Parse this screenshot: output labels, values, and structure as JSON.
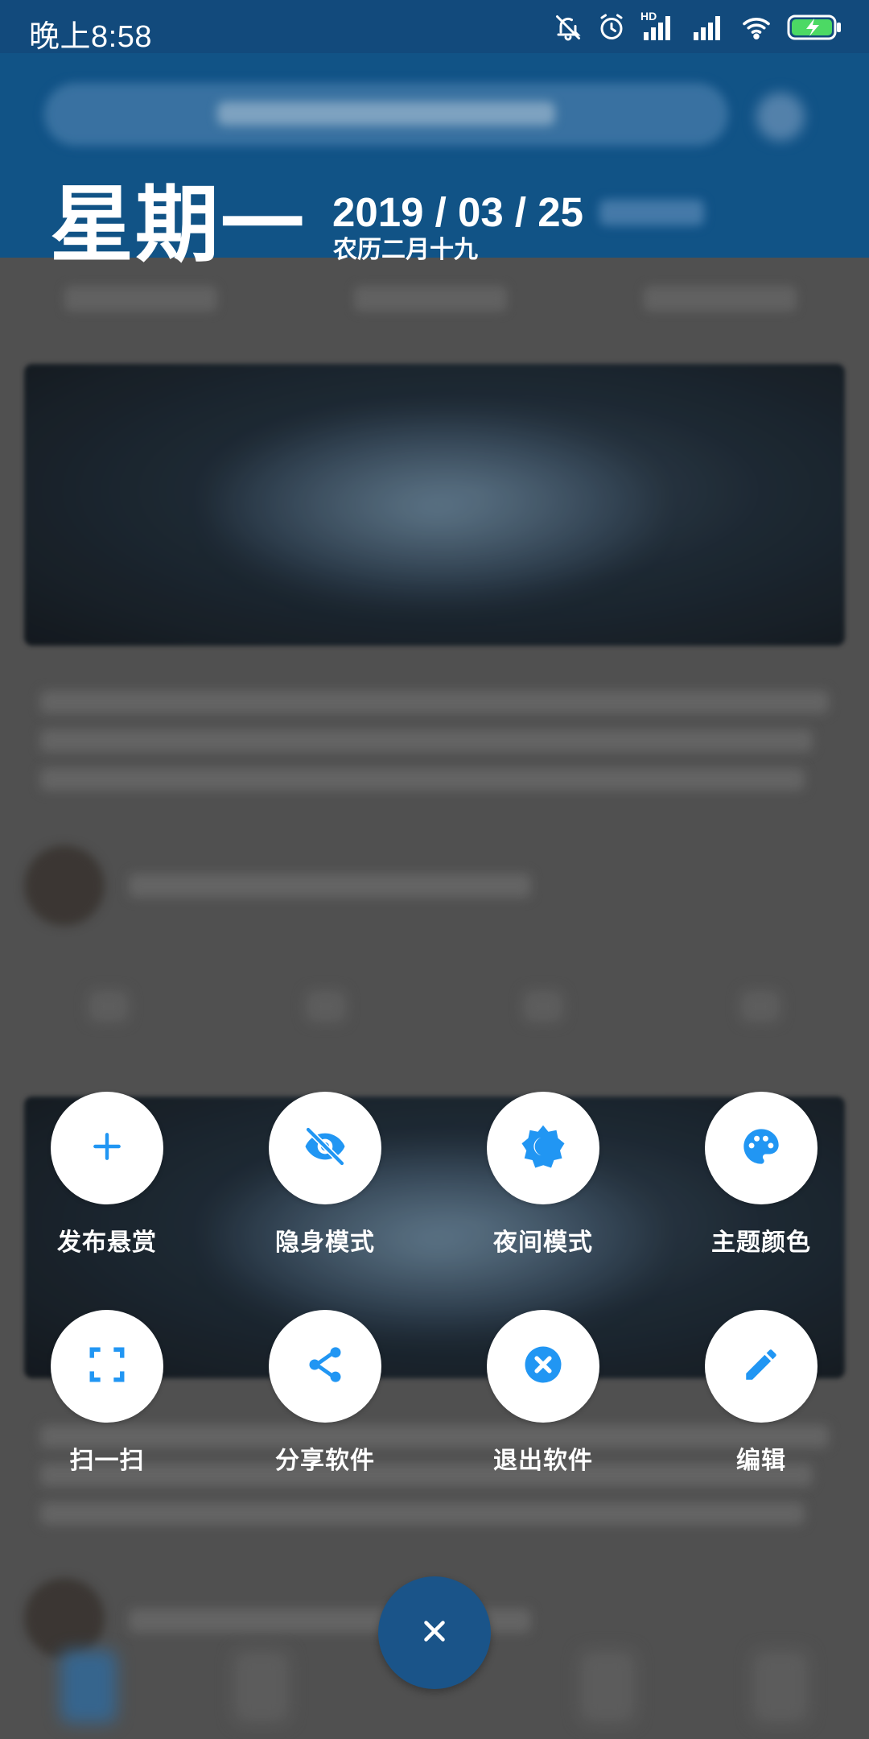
{
  "status_bar": {
    "time": "晚上8:58",
    "icons": [
      "mute-icon",
      "alarm-icon",
      "hd-signal-icon",
      "signal-icon",
      "wifi-icon",
      "battery-charging-icon"
    ],
    "hd_label": "HD"
  },
  "header": {
    "weekday": "星期一",
    "date": "2019 / 03 / 25",
    "lunar": "农历二月十九"
  },
  "menu": {
    "items": [
      {
        "label": "发布悬赏",
        "icon": "plus-icon"
      },
      {
        "label": "隐身模式",
        "icon": "eye-off-icon"
      },
      {
        "label": "夜间模式",
        "icon": "night-mode-icon"
      },
      {
        "label": "主题颜色",
        "icon": "palette-icon"
      },
      {
        "label": "扫一扫",
        "icon": "scan-icon"
      },
      {
        "label": "分享软件",
        "icon": "share-icon"
      },
      {
        "label": "退出软件",
        "icon": "exit-icon"
      },
      {
        "label": "编辑",
        "icon": "edit-icon"
      }
    ]
  },
  "close_button": {
    "icon": "close-icon"
  },
  "colors": {
    "accent": "#2196F3",
    "header_blue": "#0f5a95",
    "fab_blue": "#1a5489",
    "battery_green": "#4cd964"
  }
}
